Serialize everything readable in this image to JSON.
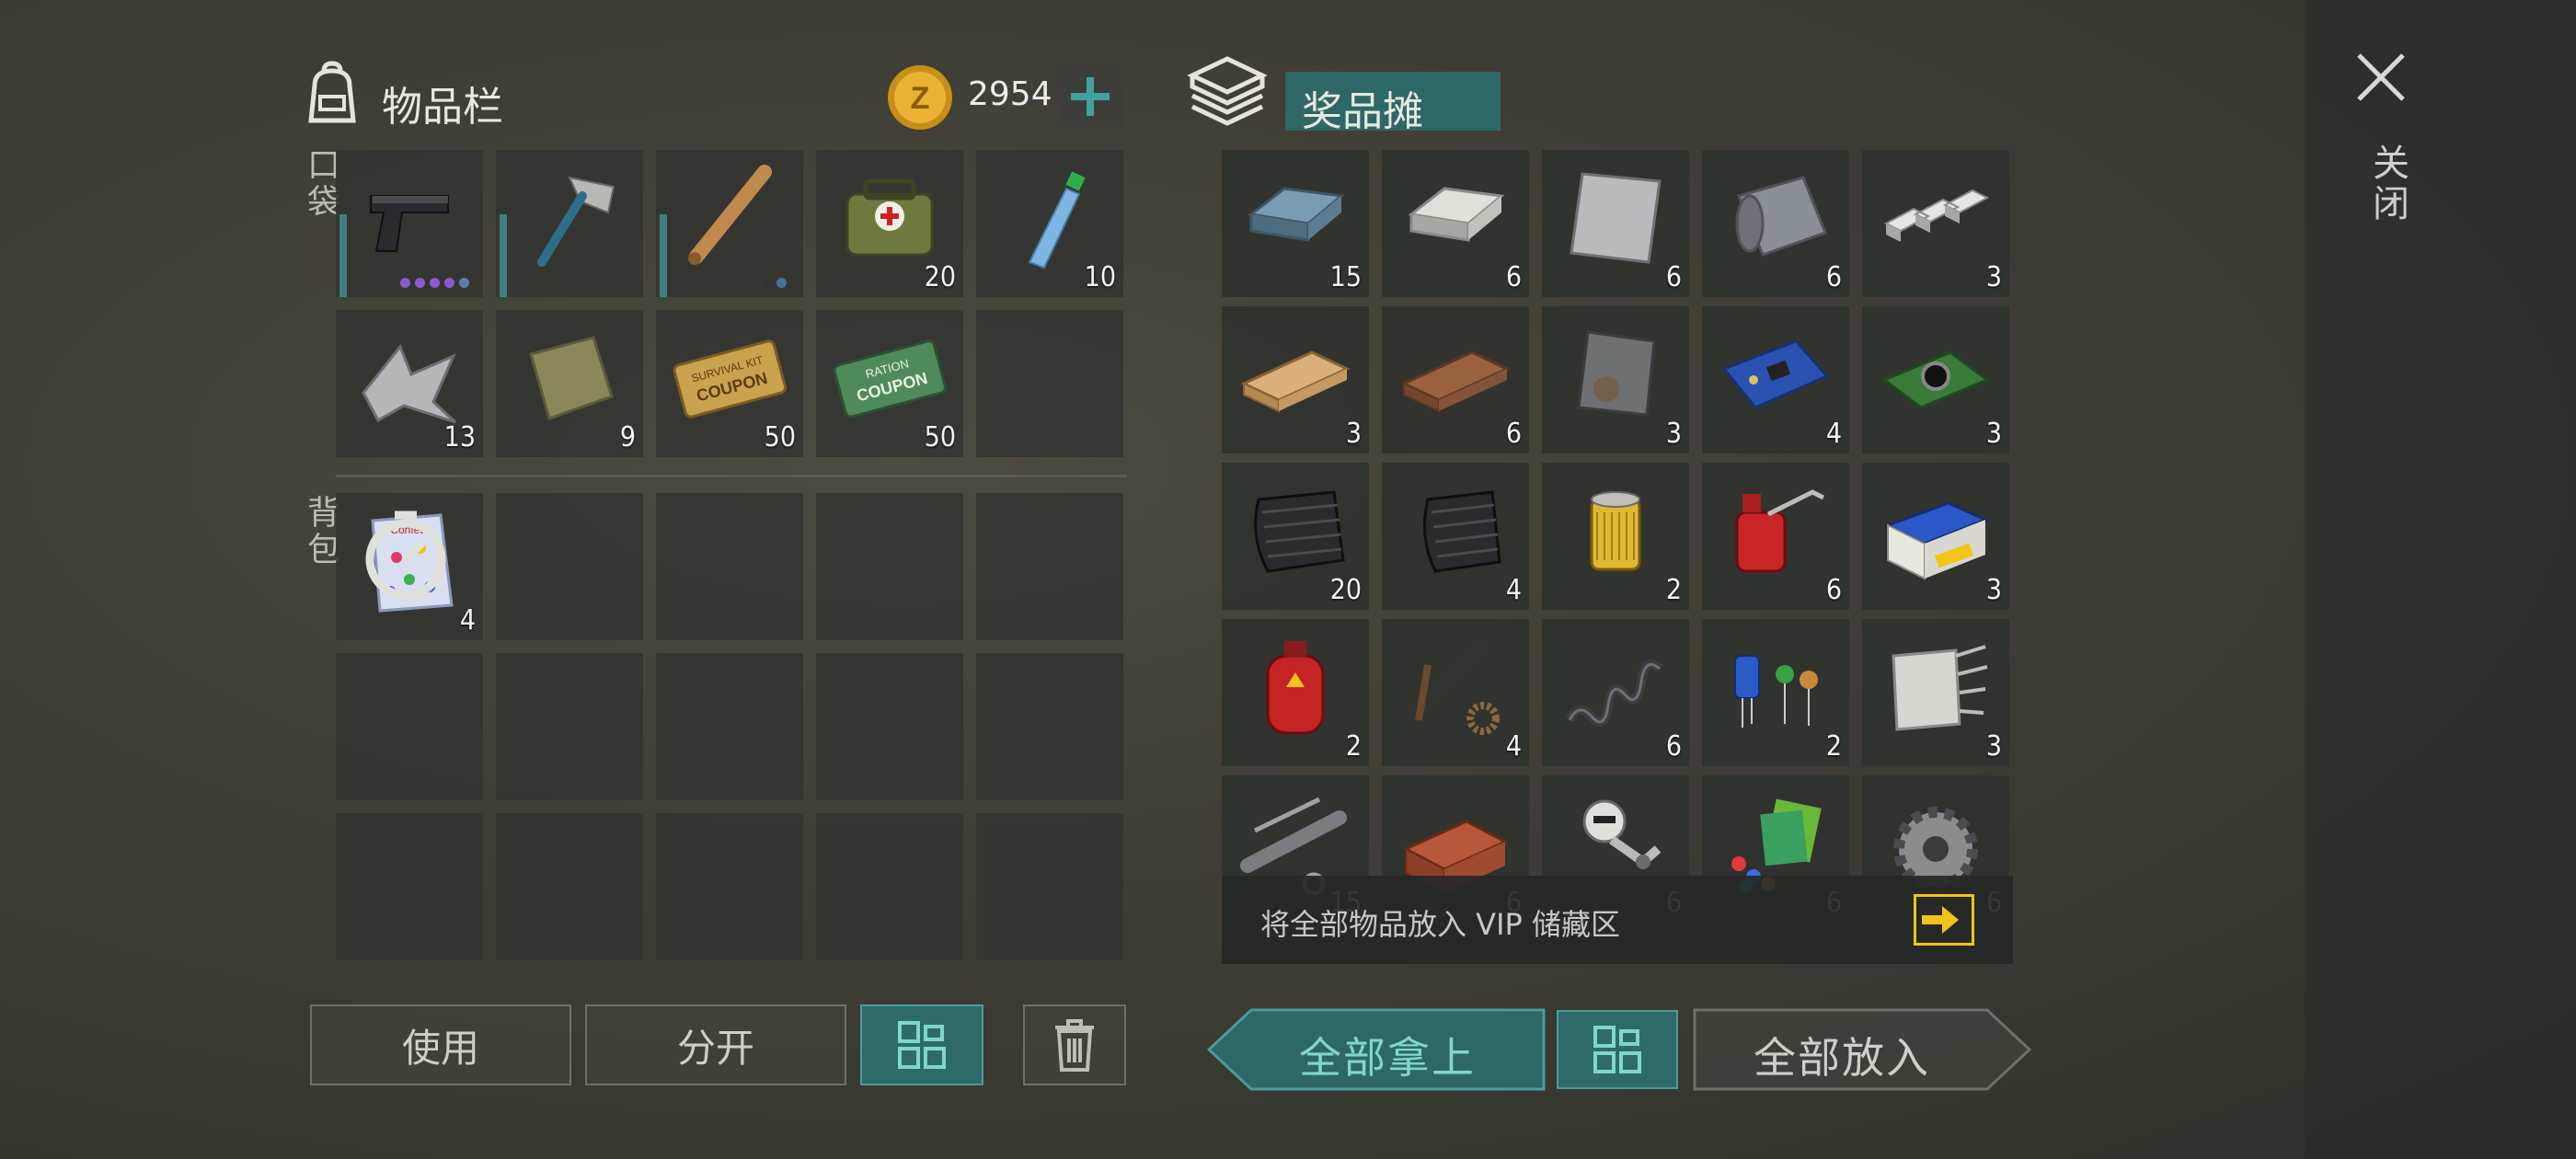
{
  "inventory": {
    "title": "物品栏",
    "coins": "2954",
    "pocket_label": "口袋",
    "backpack_label": "背包",
    "pocket_items": [
      {
        "name": "pistol",
        "qty": "",
        "dots": [
          "#8a5bd1",
          "#8a5bd1",
          "#8a5bd1",
          "#8a5bd1",
          "#5a7fa8"
        ]
      },
      {
        "name": "hatchet",
        "qty": ""
      },
      {
        "name": "baseball-bat",
        "qty": "",
        "dots": [
          "#333333",
          "#4a70a0"
        ]
      },
      {
        "name": "first-aid-bag",
        "qty": "20"
      },
      {
        "name": "water-bottle",
        "qty": "10"
      },
      {
        "name": "scrap-metal",
        "qty": "13"
      },
      {
        "name": "cloth-rag",
        "qty": "9"
      },
      {
        "name": "survival-kit-coupon",
        "qty": "50",
        "text": [
          "SURVIVAL KIT",
          "COUPON"
        ]
      },
      {
        "name": "ration-coupon",
        "qty": "50",
        "text": [
          "RATION",
          "COUPON"
        ]
      },
      {
        "name": "empty",
        "qty": ""
      }
    ],
    "backpack_items": [
      {
        "name": "confetti-bag",
        "qty": "4",
        "text": "Confetti"
      }
    ]
  },
  "reward_booth": {
    "title": "奖品摊",
    "items": [
      {
        "name": "iron-ingot",
        "qty": "15"
      },
      {
        "name": "silver-ingot",
        "qty": "6"
      },
      {
        "name": "steel-plate",
        "qty": "6"
      },
      {
        "name": "metal-roll",
        "qty": "6"
      },
      {
        "name": "silver-bars",
        "qty": "3"
      },
      {
        "name": "wood-plank",
        "qty": "3"
      },
      {
        "name": "dark-wood-plank",
        "qty": "6"
      },
      {
        "name": "rusty-plate",
        "qty": "3"
      },
      {
        "name": "circuit-board",
        "qty": "4"
      },
      {
        "name": "camera-module",
        "qty": "3"
      },
      {
        "name": "carbon-fiber",
        "qty": "20"
      },
      {
        "name": "carbon-cloth",
        "qty": "4"
      },
      {
        "name": "oil-filter",
        "qty": "2"
      },
      {
        "name": "oil-can",
        "qty": "6"
      },
      {
        "name": "car-battery",
        "qty": "3"
      },
      {
        "name": "gas-cylinder",
        "qty": "2"
      },
      {
        "name": "mechanical-parts",
        "qty": "4"
      },
      {
        "name": "spring",
        "qty": "6"
      },
      {
        "name": "capacitors",
        "qty": "2"
      },
      {
        "name": "fiberglass",
        "qty": "3"
      },
      {
        "name": "pipes",
        "qty": "15"
      },
      {
        "name": "brick",
        "qty": "6"
      },
      {
        "name": "robot-parts",
        "qty": "6"
      },
      {
        "name": "plastic-parts",
        "qty": "6"
      },
      {
        "name": "gear",
        "qty": "6"
      }
    ],
    "vip_text": "将全部物品放入 VIP 储藏区"
  },
  "buttons": {
    "use": "使用",
    "split": "分开",
    "take_all": "全部拿上",
    "put_all": "全部放入"
  },
  "close_label": "关闭",
  "colors": {
    "teal": "#2f6a6a",
    "accent_teal": "#7fd6cf",
    "coin": "#e0a52a",
    "arrow_yellow": "#f2c318"
  }
}
